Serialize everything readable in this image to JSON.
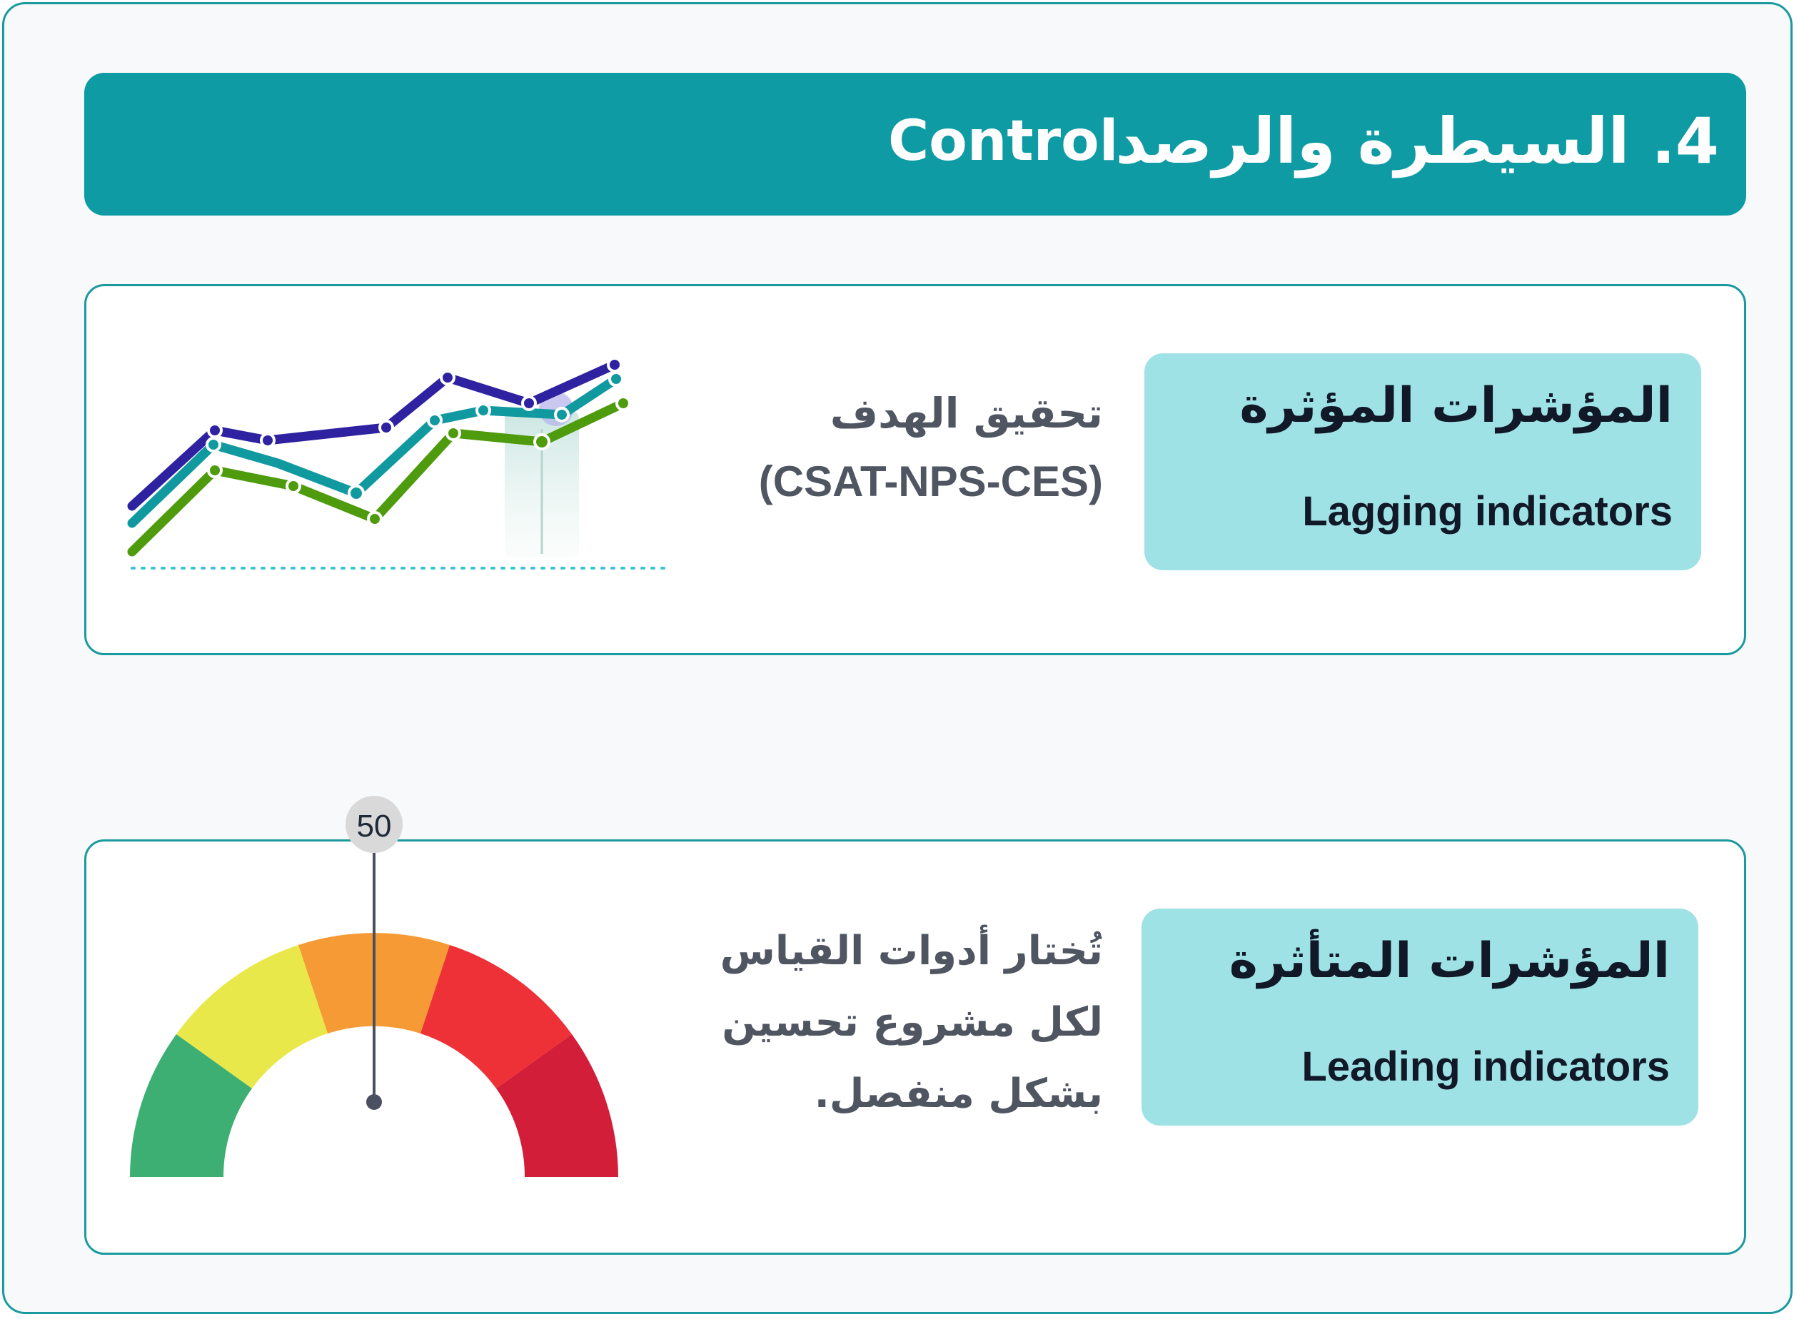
{
  "header": {
    "title_ar": "4. السيطرة والرصد",
    "title_en": "Control",
    "background_color": "#0e9ba4"
  },
  "lagging": {
    "label_ar": "المؤشرات المؤثرة",
    "label_en": "Lagging indicators",
    "desc_ar": "تحقيق الهدف",
    "desc_metrics": "(CSAT-NPS-CES)",
    "chart_icon": "multi-line-trend-icon",
    "series_colors": [
      "#2e22a0",
      "#1199a0",
      "#4e9b0e"
    ]
  },
  "leading": {
    "label_ar": "المؤشرات المتأثرة",
    "label_en": "Leading indicators",
    "desc_lines": [
      "تُختار أدوات القياس",
      "لكل مشروع تحسين",
      "بشكل منفصل."
    ],
    "gauge_icon": "gauge-meter-icon",
    "gauge_value": "50",
    "gauge_colors": [
      "#3daf72",
      "#e8e84a",
      "#f59a35",
      "#ee3136",
      "#d31e3a"
    ]
  }
}
